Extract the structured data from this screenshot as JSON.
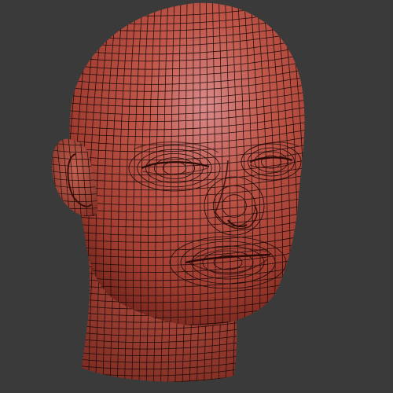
{
  "viewport": {
    "background_color": "#3a3a3a",
    "mesh": {
      "subject": "head-wireframe-mesh",
      "surface_color": "#b84a3c",
      "surface_highlight_color": "#d98a8a",
      "surface_shadow_color": "#6e2219",
      "wire_color": "#1a0a08"
    }
  }
}
